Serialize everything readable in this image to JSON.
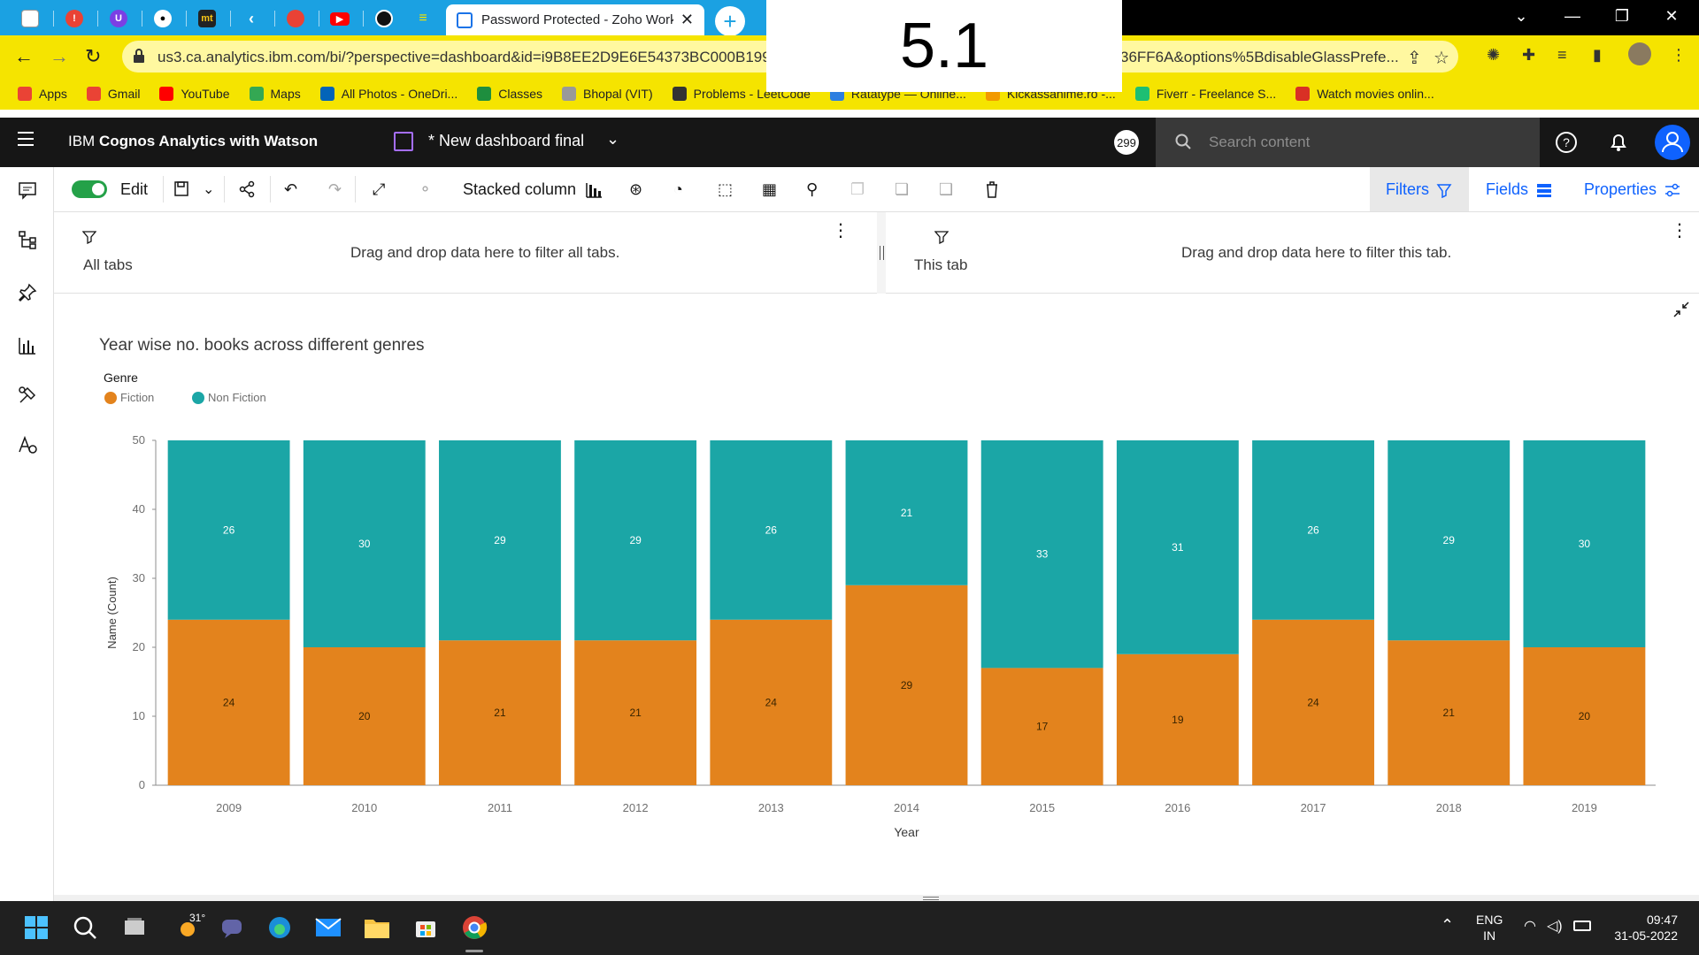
{
  "browser": {
    "active_tab_title": "Password Protected - Zoho Work",
    "url_left": "us3.ca.analytics.ibm.com/bi/?perspective=dashboard&id=i9B8EE2D9E6E54373BC000B199",
    "url_right": "36FF6A&options%5BdisableGlassPrefe...",
    "overlay_label": "5.1",
    "bookmarks": [
      {
        "label": "Apps",
        "color": "#ea4335"
      },
      {
        "label": "Gmail",
        "color": "#ea4335"
      },
      {
        "label": "YouTube",
        "color": "#ff0000"
      },
      {
        "label": "Maps",
        "color": "#34a853"
      },
      {
        "label": "All Photos - OneDri...",
        "color": "#0364b8"
      },
      {
        "label": "Classes",
        "color": "#1e8e3e"
      },
      {
        "label": "Bhopal (VIT)",
        "color": "#999999"
      },
      {
        "label": "Problems - LeetCode",
        "color": "#333333"
      },
      {
        "label": "Ratatype — Online...",
        "color": "#2d7fe0"
      },
      {
        "label": "Kickassanime.ro -...",
        "color": "#f29900"
      },
      {
        "label": "Fiverr - Freelance S...",
        "color": "#1dbf73"
      },
      {
        "label": "Watch movies onlin...",
        "color": "#d93025"
      }
    ]
  },
  "app": {
    "brand_prefix": "IBM",
    "brand_name": "Cognos Analytics with Watson",
    "dashboard_name": "* New dashboard final",
    "notification_count": "299",
    "search_placeholder": "Search content"
  },
  "toolbar": {
    "edit_label": "Edit",
    "visualization_type": "Stacked column",
    "filters_label": "Filters",
    "fields_label": "Fields",
    "properties_label": "Properties"
  },
  "filters": {
    "all_tabs_label": "All tabs",
    "all_tabs_hint": "Drag and drop data here to filter all tabs.",
    "this_tab_label": "This tab",
    "this_tab_hint": "Drag and drop data here to filter this tab."
  },
  "chart_data": {
    "type": "bar",
    "stacked": true,
    "title": "Year wise no. books across different genres",
    "legend_title": "Genre",
    "legend_placement": "top-left",
    "xlabel": "Year",
    "ylabel": "Name (Count)",
    "ylim": [
      0,
      50
    ],
    "yticks": [
      0,
      10,
      20,
      30,
      40,
      50
    ],
    "categories": [
      "2009",
      "2010",
      "2011",
      "2012",
      "2013",
      "2014",
      "2015",
      "2016",
      "2017",
      "2018",
      "2019"
    ],
    "series": [
      {
        "name": "Fiction",
        "color": "#e3831d",
        "values": [
          24,
          20,
          21,
          21,
          24,
          29,
          17,
          19,
          24,
          21,
          20
        ]
      },
      {
        "name": "Non Fiction",
        "color": "#1ba6a6",
        "values": [
          26,
          30,
          29,
          29,
          26,
          21,
          33,
          31,
          26,
          29,
          30
        ]
      }
    ]
  },
  "taskbar": {
    "temperature": "31°",
    "language_line1": "ENG",
    "language_line2": "IN",
    "time": "09:47",
    "date": "31-05-2022"
  }
}
